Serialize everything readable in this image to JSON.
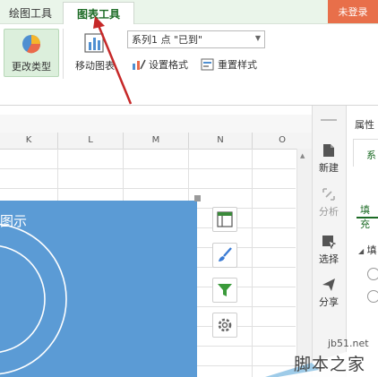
{
  "ribbon": {
    "tabs": [
      {
        "label": "绘图工具"
      },
      {
        "label": "图表工具"
      }
    ],
    "login_label": "未登录",
    "buttons": {
      "change_type": "更改类型",
      "move_chart": "移动图表",
      "set_format": "设置格式",
      "reset_style": "重置样式"
    },
    "series_select": {
      "value": "系列1 点 \"已到\""
    }
  },
  "sheet": {
    "columns": [
      "K",
      "L",
      "M",
      "N",
      "O"
    ],
    "chart_title": "图示"
  },
  "side": {
    "items": [
      {
        "label": "新建"
      },
      {
        "label": "分析"
      },
      {
        "label": "选择"
      },
      {
        "label": "分享"
      }
    ]
  },
  "prop_pane": {
    "title": "属性",
    "tab1": "系",
    "tab2": "填充",
    "section": "填"
  },
  "watermark": {
    "domain": "jb51.net",
    "brand": "脚本之家"
  },
  "colors": {
    "accent_green": "#1c6b25",
    "chart_blue": "#5b9bd5",
    "login_orange": "#e86f4a",
    "arrow_red": "#c62828"
  }
}
